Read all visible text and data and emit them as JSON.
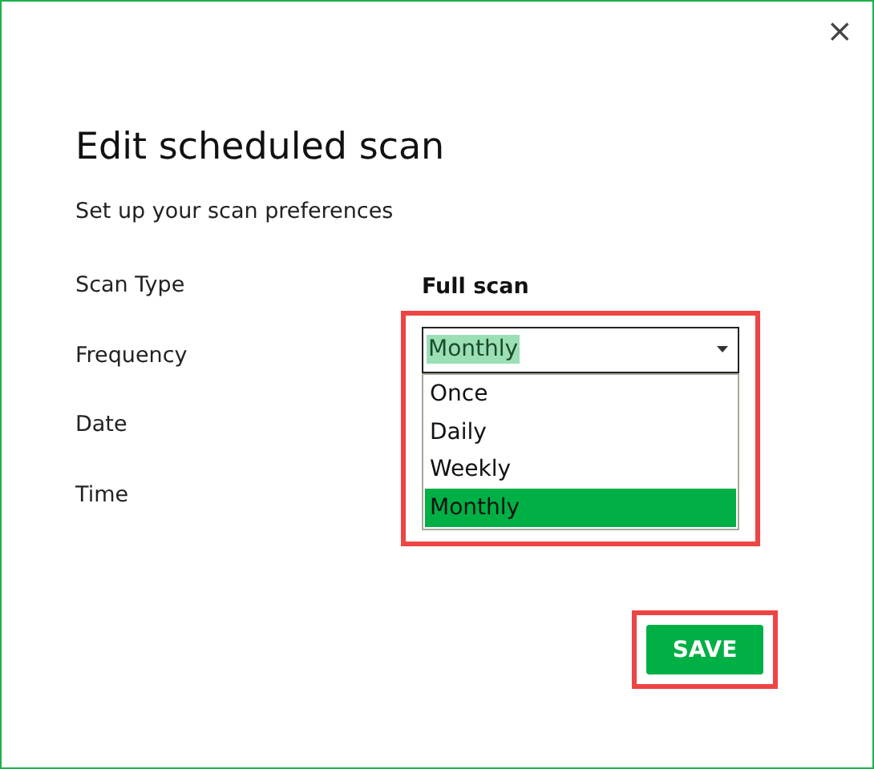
{
  "window": {
    "close": "×"
  },
  "title": "Edit scheduled scan",
  "subtitle": "Set up your scan preferences",
  "fields": [
    {
      "label": "Scan Type",
      "kind": "text",
      "value": "Full scan"
    },
    {
      "label": "Frequency",
      "kind": "dropdown",
      "value": "Monthly",
      "expanded": true,
      "highlighted": true,
      "options": [
        {
          "label": "Once",
          "selected": false
        },
        {
          "label": "Daily",
          "selected": false
        },
        {
          "label": "Weekly",
          "selected": false
        },
        {
          "label": "Monthly",
          "selected": true
        }
      ]
    },
    {
      "label": "Date",
      "kind": "empty"
    },
    {
      "label": "Time",
      "kind": "empty"
    }
  ],
  "save_button": {
    "label": "SAVE",
    "highlighted": true
  }
}
